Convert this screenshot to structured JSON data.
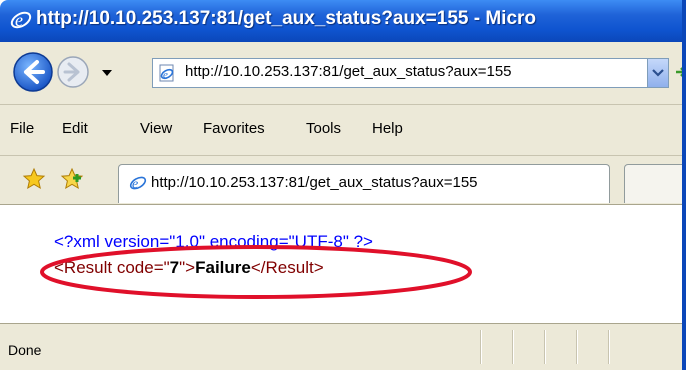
{
  "window": {
    "title": "http://10.10.253.137:81/get_aux_status?aux=155 - Micro"
  },
  "address_bar": {
    "url": "http://10.10.253.137:81/get_aux_status?aux=155"
  },
  "menu": {
    "items": [
      "File",
      "Edit",
      "View",
      "Favorites",
      "Tools",
      "Help"
    ]
  },
  "tab": {
    "label": "http://10.10.253.137:81/get_aux_status?aux=155"
  },
  "content": {
    "line1": "<?xml version=\"1.0\" encoding=\"UTF-8\" ?>",
    "line2": {
      "open_tag": "<Result code=\"",
      "code": "7",
      "close_quote": "\">",
      "value": "Failure",
      "close_tag": "</Result>"
    }
  },
  "status": {
    "text": "Done"
  },
  "colors": {
    "titlebar": "#0f54d0",
    "chrome": "#ece9d8",
    "xml_decl": "#0000ff",
    "xml_tag": "#800000",
    "highlight_ellipse": "#e0102a"
  }
}
